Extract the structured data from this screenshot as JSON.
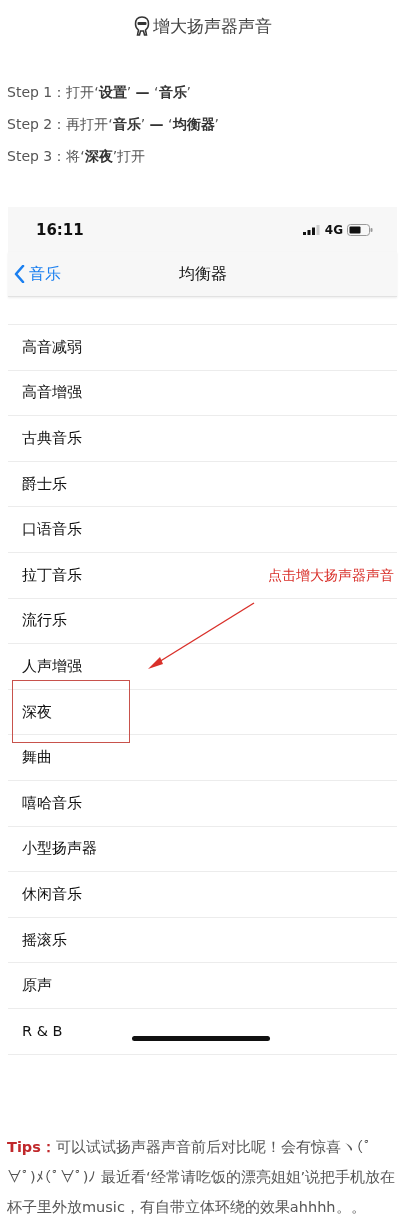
{
  "header": {
    "title": "增大扬声器声音"
  },
  "steps": [
    {
      "label": "Step 1：",
      "text": "打开‘**设置**’ **—** ‘**音乐**’"
    },
    {
      "label": "Step 2：",
      "text": "再打开‘**音乐**’ **—** ‘**均衡器**’"
    },
    {
      "label": "Step 3：",
      "text": "将‘**深夜**’打开"
    }
  ],
  "phone": {
    "status_bar": {
      "time": "16:11",
      "network": "4G"
    },
    "nav": {
      "back": "音乐",
      "title": "均衡器"
    },
    "items": [
      {
        "label": "高音减弱",
        "highlighted": false
      },
      {
        "label": "高音增强",
        "highlighted": false
      },
      {
        "label": "古典音乐",
        "highlighted": false
      },
      {
        "label": "爵士乐",
        "highlighted": false
      },
      {
        "label": "口语音乐",
        "highlighted": false
      },
      {
        "label": "拉丁音乐",
        "highlighted": false
      },
      {
        "label": "流行乐",
        "highlighted": false
      },
      {
        "label": "人声增强",
        "highlighted": false
      },
      {
        "label": "深夜",
        "highlighted": true
      },
      {
        "label": "舞曲",
        "highlighted": false
      },
      {
        "label": "嘻哈音乐",
        "highlighted": false
      },
      {
        "label": "小型扬声器",
        "highlighted": false
      },
      {
        "label": "休闲音乐",
        "highlighted": false
      },
      {
        "label": "摇滚乐",
        "highlighted": false
      },
      {
        "label": "原声",
        "highlighted": false
      },
      {
        "label": "R & B",
        "highlighted": false
      }
    ],
    "annotation": {
      "text": "点击增大扬声器声音"
    }
  },
  "tips": {
    "text": "**Tips：**可以试试扬声器声音前后对比呢！会有惊喜ヽ(ﾟ∀ﾟ)ﾒ(ﾟ∀ﾟ)ﾉ 最近看‘经常请吃饭的漂亮姐姐’说把手机放在杯子里外放music，有自带立体环绕的效果ahhhh。。"
  }
}
